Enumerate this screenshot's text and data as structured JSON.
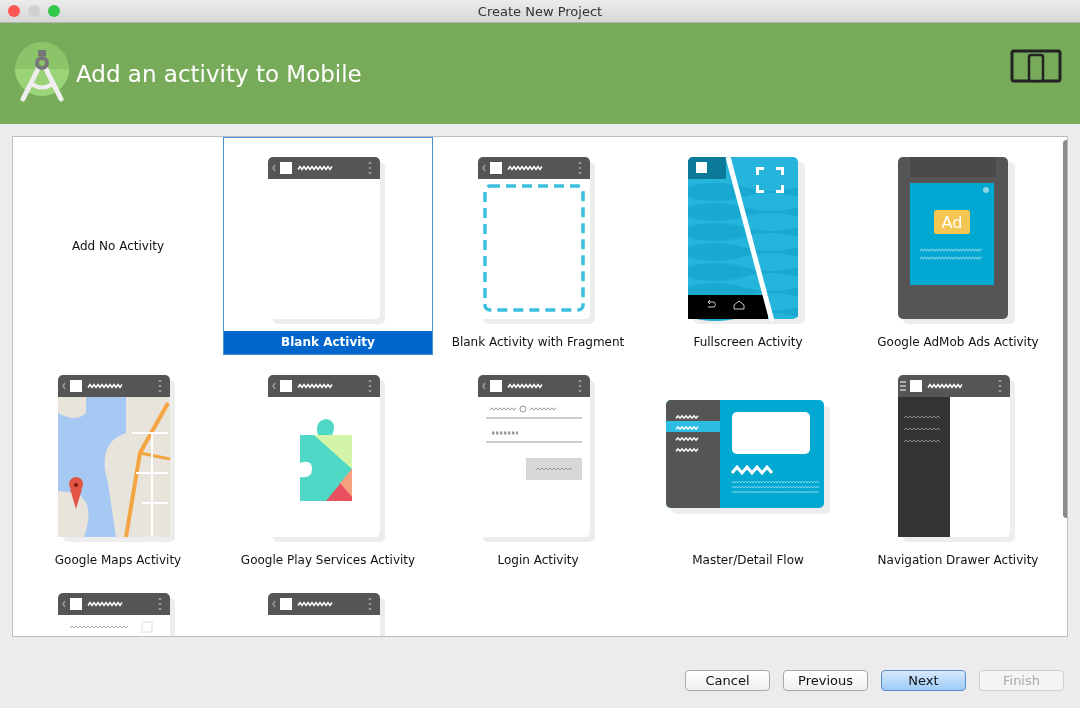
{
  "window": {
    "title": "Create New Project"
  },
  "header": {
    "title": "Add an activity to Mobile"
  },
  "activities": [
    {
      "kind": "none",
      "label": "Add No Activity",
      "selected": false
    },
    {
      "kind": "blank",
      "label": "Blank Activity",
      "selected": true
    },
    {
      "kind": "fragment",
      "label": "Blank Activity with Fragment",
      "selected": false
    },
    {
      "kind": "fullscreen",
      "label": "Fullscreen Activity",
      "selected": false
    },
    {
      "kind": "admob",
      "label": "Google AdMob Ads Activity",
      "selected": false,
      "ad_label": "Ad"
    },
    {
      "kind": "maps",
      "label": "Google Maps Activity",
      "selected": false
    },
    {
      "kind": "play",
      "label": "Google Play Services Activity",
      "selected": false
    },
    {
      "kind": "login",
      "label": "Login Activity",
      "selected": false
    },
    {
      "kind": "masterdetail",
      "label": "Master/Detail Flow",
      "selected": false
    },
    {
      "kind": "navdrawer",
      "label": "Navigation Drawer Activity",
      "selected": false
    },
    {
      "kind": "list",
      "selected": false
    },
    {
      "kind": "blank",
      "selected": false
    }
  ],
  "buttons": [
    {
      "label": "Cancel",
      "default": false,
      "disabled": false
    },
    {
      "label": "Previous",
      "default": false,
      "disabled": false
    },
    {
      "label": "Next",
      "default": true,
      "disabled": false
    },
    {
      "label": "Finish",
      "default": false,
      "disabled": true
    }
  ]
}
